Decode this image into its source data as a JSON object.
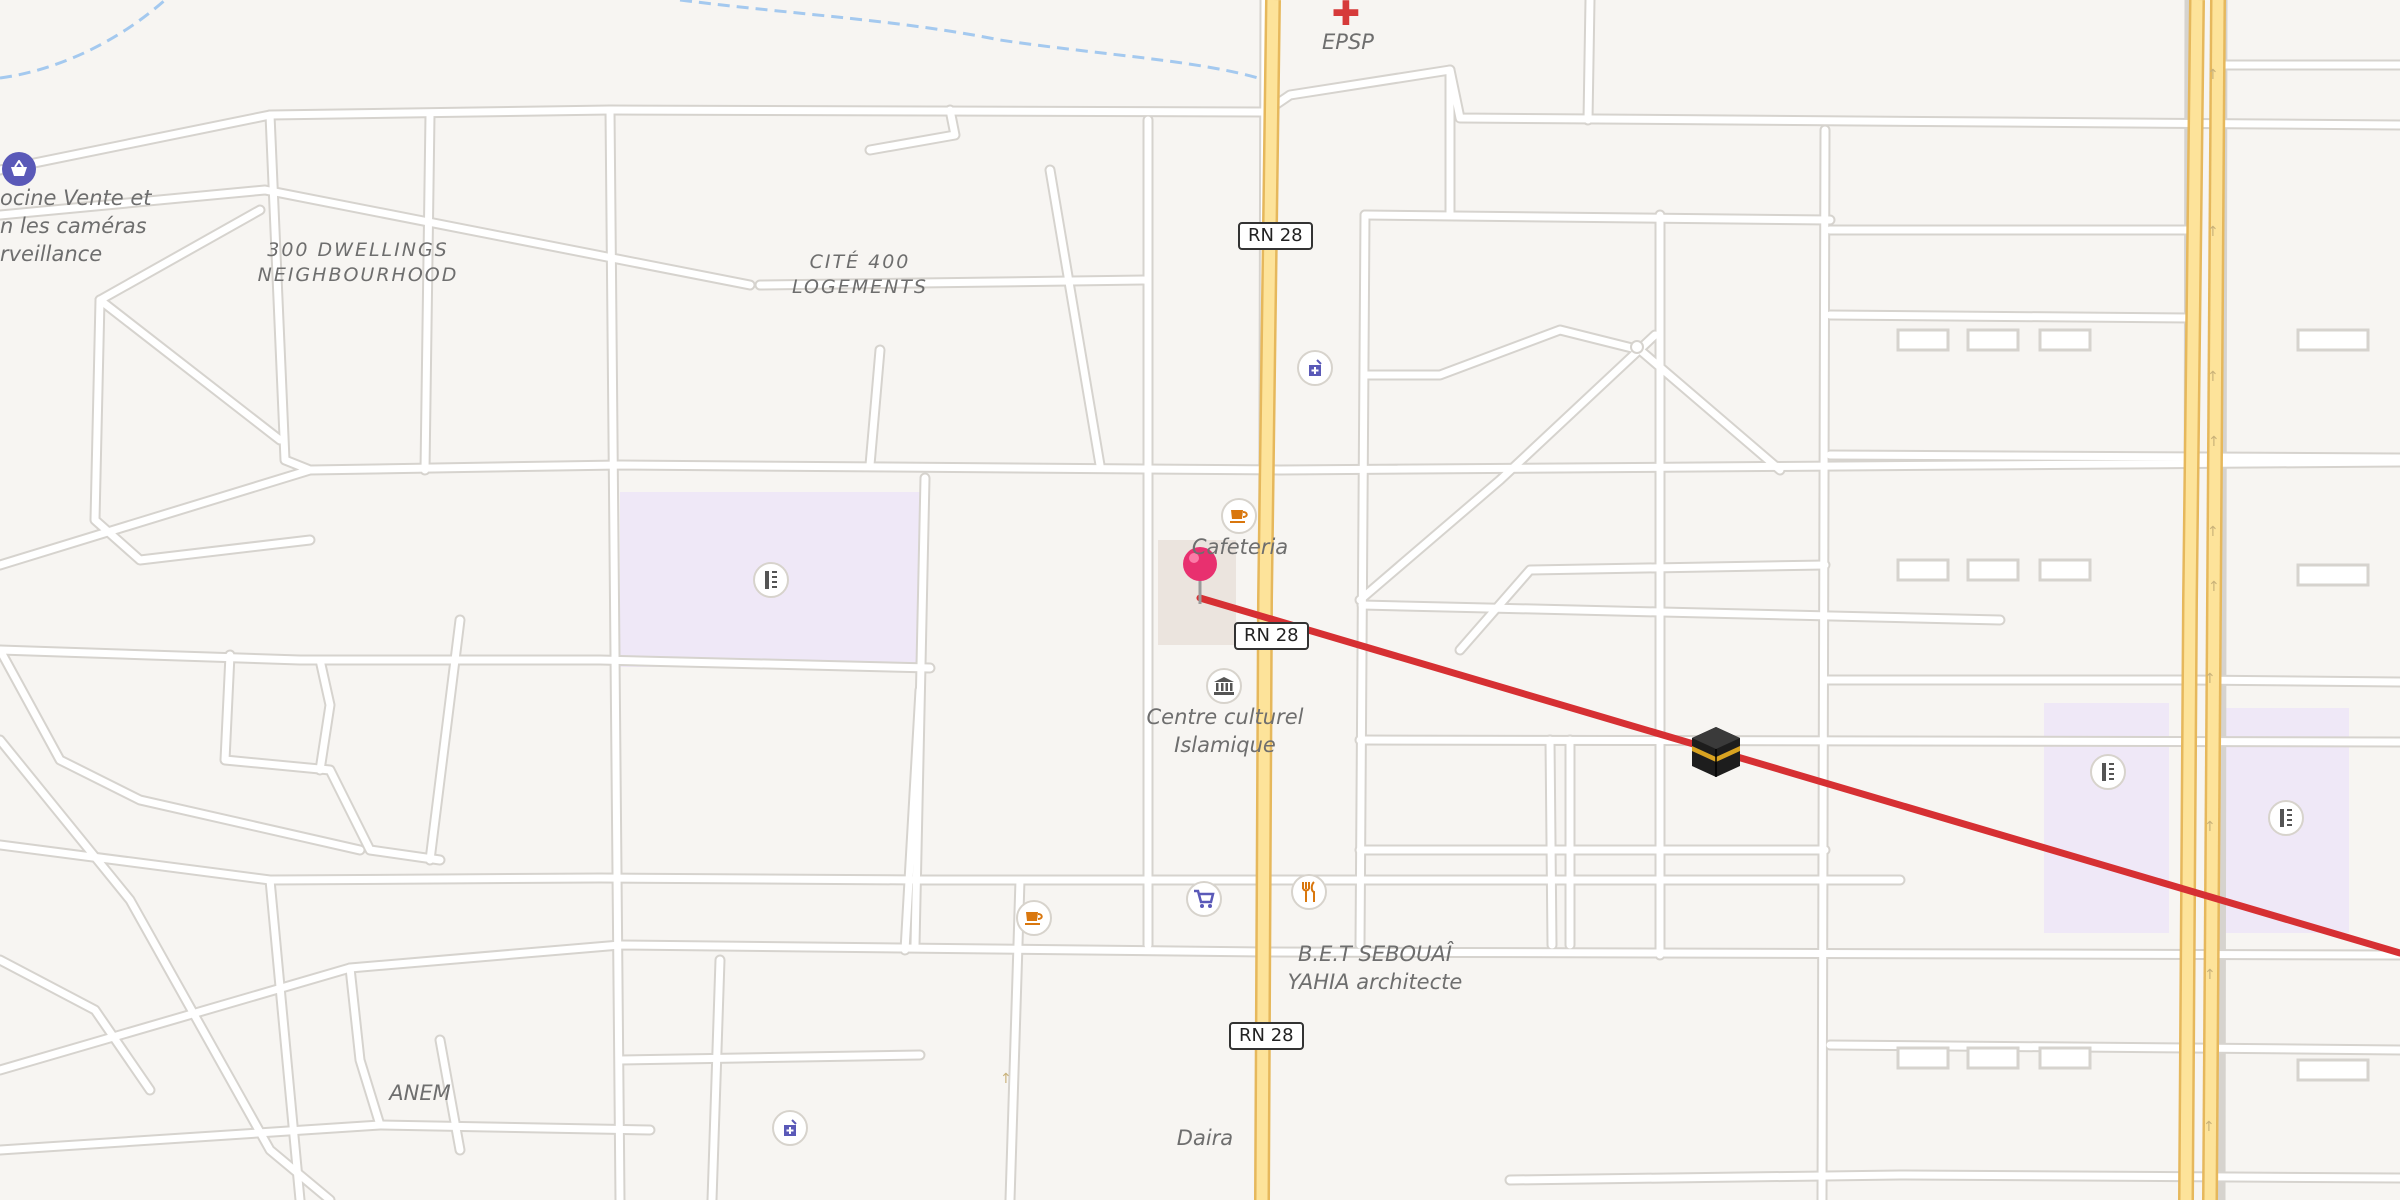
{
  "map": {
    "road_ref": "RN 28",
    "colors": {
      "background": "#f7f5f2",
      "highway": "#fde39a",
      "school_area": "#efe8f7",
      "route_line": "#d63033",
      "pin": "#e8306f"
    }
  },
  "labels": {
    "epsp": "EPSP",
    "shop_line1": "ocine Vente et",
    "shop_line2": "n les caméras",
    "shop_line3": "rveillance",
    "dwellings_line1": "300 DWELLINGS",
    "dwellings_line2": "NEIGHBOURHOOD",
    "cite_line1": "CITÉ 400",
    "cite_line2": "LOGEMENTS",
    "cafeteria": "Cafeteria",
    "centre_line1": "Centre culturel",
    "centre_line2": "Islamique",
    "bet_line1": "B.E.T SEBOUAÎ",
    "bet_line2": "YAHIA architecte",
    "anem": "ANEM",
    "daira": "Daira"
  },
  "pois": [
    {
      "icon": "hospital-cross-icon"
    },
    {
      "icon": "shopping-basket-icon"
    },
    {
      "icon": "pharmacy-icon"
    },
    {
      "icon": "school-icon"
    },
    {
      "icon": "cafe-icon"
    },
    {
      "icon": "museum-icon"
    },
    {
      "icon": "restaurant-icon"
    },
    {
      "icon": "shopping-cart-icon"
    },
    {
      "icon": "kaaba-qibla-icon"
    }
  ]
}
